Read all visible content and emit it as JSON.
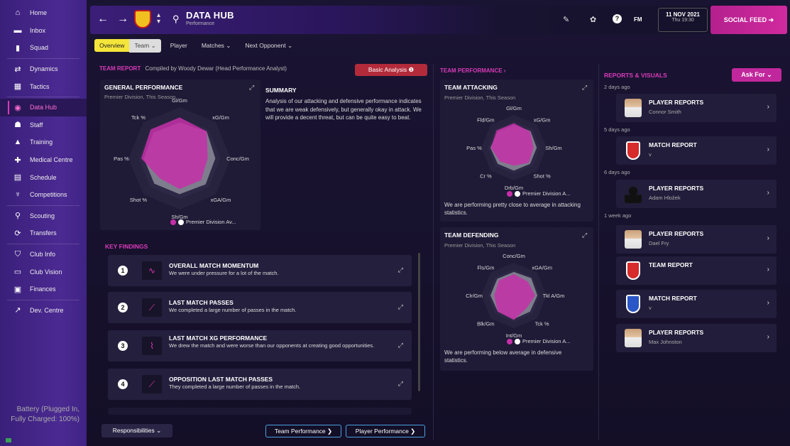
{
  "sidebar": {
    "items": [
      {
        "label": "Home",
        "icon": "home-icon",
        "glyph": "⌂",
        "active": false
      },
      {
        "label": "Inbox",
        "icon": "inbox-icon",
        "glyph": "▬",
        "active": false
      },
      {
        "label": "Squad",
        "icon": "squad-icon",
        "glyph": "▮",
        "active": false
      },
      {
        "label": "Dynamics",
        "icon": "dynamics-icon",
        "glyph": "⇄",
        "active": false
      },
      {
        "label": "Tactics",
        "icon": "tactics-icon",
        "glyph": "▦",
        "active": false
      },
      {
        "label": "Data Hub",
        "icon": "data-hub-icon",
        "glyph": "◉",
        "active": true
      },
      {
        "label": "Staff",
        "icon": "staff-icon",
        "glyph": "☗",
        "active": false
      },
      {
        "label": "Training",
        "icon": "training-icon",
        "glyph": "▲",
        "active": false
      },
      {
        "label": "Medical Centre",
        "icon": "medical-icon",
        "glyph": "✚",
        "active": false
      },
      {
        "label": "Schedule",
        "icon": "schedule-icon",
        "glyph": "▤",
        "active": false
      },
      {
        "label": "Competitions",
        "icon": "trophy-icon",
        "glyph": "♆",
        "active": false
      },
      {
        "label": "Scouting",
        "icon": "scouting-icon",
        "glyph": "⚲",
        "active": false
      },
      {
        "label": "Transfers",
        "icon": "transfers-icon",
        "glyph": "⟳",
        "active": false
      },
      {
        "label": "Club Info",
        "icon": "club-info-icon",
        "glyph": "⛉",
        "active": false
      },
      {
        "label": "Club Vision",
        "icon": "club-vision-icon",
        "glyph": "▭",
        "active": false
      },
      {
        "label": "Finances",
        "icon": "finances-icon",
        "glyph": "▣",
        "active": false
      },
      {
        "label": "Dev. Centre",
        "icon": "dev-centre-icon",
        "glyph": "↗",
        "active": false
      }
    ],
    "battery": "Battery (Plugged In, Fully Charged: 100%)"
  },
  "header": {
    "title": "DATA HUB",
    "subtitle": "Performance",
    "date": "11 NOV 2021",
    "time": "Thu 19:30",
    "fm_label": "FM",
    "social_feed": "SOCIAL FEED ➔"
  },
  "tabs": [
    "Overview",
    "Team ⌄",
    "Player",
    "Matches ⌄",
    "Next Opponent ⌄"
  ],
  "team_report": {
    "label": "TEAM REPORT",
    "compiled_by": "Compiled by Woody Dewar (Head Performance Analyst)",
    "basic_analysis": "Basic Analysis ❶"
  },
  "general_performance": {
    "title": "GENERAL PERFORMANCE",
    "subtitle": "Premier Division, This Season",
    "labels": [
      "Gl/Gm",
      "xG/Gm",
      "Conc/Gm",
      "xGA/Gm",
      "Sh/Gm",
      "Shot %",
      "Pas %",
      "Tck %"
    ],
    "legend": "Premier Division Av..."
  },
  "summary": {
    "title": "SUMMARY",
    "text": "Analysis of our attacking and defensive performance indicates that we are weak defensively, but generally okay in attack. We will provide a decent threat, but can be quite easy to beat."
  },
  "key_findings": {
    "title": "KEY FINDINGS",
    "items": [
      {
        "num": "1",
        "title": "OVERALL MATCH MOMENTUM",
        "desc": "We were under pressure for a lot of the match.",
        "icon": "momentum-icon",
        "glyph": "∿"
      },
      {
        "num": "2",
        "title": "LAST MATCH PASSES",
        "desc": "We completed a large number of passes in the match.",
        "icon": "passes-icon",
        "glyph": "⟋"
      },
      {
        "num": "3",
        "title": "LAST MATCH XG PERFORMANCE",
        "desc": "We drew the match and were worse than our opponents at creating good opportunities.",
        "icon": "xg-icon",
        "glyph": "⌇"
      },
      {
        "num": "4",
        "title": "OPPOSITION LAST MATCH PASSES",
        "desc": "They completed a large number of passes in the match.",
        "icon": "passes-icon",
        "glyph": "⟋"
      }
    ]
  },
  "buttons": {
    "responsibilities": "Responsibilities ⌄",
    "team_performance": "Team Performance ❯",
    "player_performance": "Player Performance ❯"
  },
  "team_performance": {
    "label": "TEAM PERFORMANCE ›",
    "attacking": {
      "title": "TEAM ATTACKING",
      "subtitle": "Premier Division, This Season",
      "labels": [
        "Gl/Gm",
        "xG/Gm",
        "Sh/Gm",
        "Shot %",
        "Drb/Gm",
        "Cr %",
        "Pas %",
        "Fld/Gm"
      ],
      "legend": "Premier Division A...",
      "text": "We are performing pretty close to average in attacking statistics."
    },
    "defending": {
      "title": "TEAM DEFENDING",
      "subtitle": "Premier Division, This Season",
      "labels": [
        "Conc/Gm",
        "xGA/Gm",
        "Tkl A/Gm",
        "Tck %",
        "Int/Gm",
        "Blk/Gm",
        "Clr/Gm",
        "Fls/Gm"
      ],
      "legend": "Premier Division A...",
      "text": "We are performing below average in defensive statistics."
    }
  },
  "reports": {
    "title": "REPORTS & VISUALS",
    "ask_for": "Ask For ⌄",
    "times": [
      "2 days ago",
      "5 days ago",
      "6 days ago",
      "1 week ago"
    ],
    "items": [
      {
        "title": "PLAYER REPORTS",
        "sub": "Connor Smith",
        "kind": "player"
      },
      {
        "title": "MATCH REPORT",
        "sub": "v",
        "kind": "report"
      },
      {
        "title": "PLAYER REPORTS",
        "sub": "Adam Hložek",
        "kind": "silhouette"
      },
      {
        "title": "PLAYER REPORTS",
        "sub": "Dael Fry",
        "kind": "player"
      },
      {
        "title": "TEAM REPORT",
        "sub": "",
        "kind": "report"
      },
      {
        "title": "MATCH REPORT",
        "sub": "v",
        "kind": "shield"
      },
      {
        "title": "PLAYER REPORTS",
        "sub": "Max Johnston",
        "kind": "player"
      }
    ]
  },
  "colors": {
    "accent": "#d93ab8",
    "team_fill": "#c62fa8",
    "avg_fill": "#8c8c9a"
  }
}
